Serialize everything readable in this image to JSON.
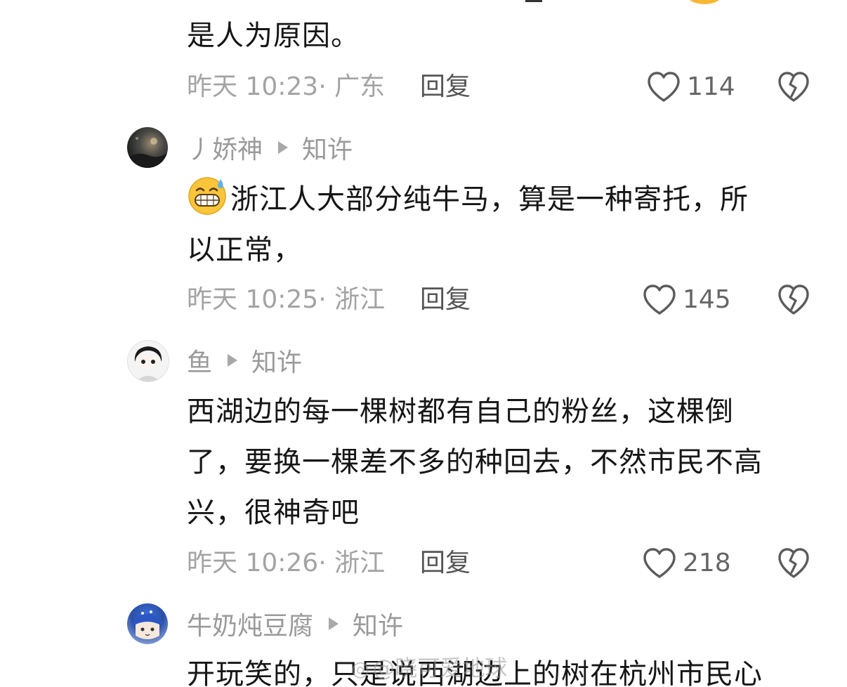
{
  "comments": [
    {
      "text_lines": [
        "是人为原因。"
      ],
      "time": "昨天 10:23· 广东",
      "reply": "回复",
      "likes": "114"
    },
    {
      "author": "丿娇神",
      "replied_to": "知许",
      "emoji": "grinning-sweat-emoji",
      "text_lines": [
        "浙江人大部分纯牛马，算是一种寄托，所",
        "以正常，"
      ],
      "time": "昨天 10:25· 浙江",
      "reply": "回复",
      "likes": "145"
    },
    {
      "author": "鱼",
      "replied_to": "知许",
      "text_lines": [
        "西湖边的每一棵树都有自己的粉丝，这棵倒",
        "了，要换一棵差不多的种回去，不然市民不高",
        "兴，很神奇吧"
      ],
      "time": "昨天 10:26· 浙江",
      "reply": "回复",
      "likes": "218"
    },
    {
      "author": "牛奶炖豆腐",
      "replied_to": "知许",
      "text_lines": [
        "开玩笑的，只是说西湖边上的树在杭州市民心"
      ]
    }
  ],
  "watermark": "@晓可爱地球",
  "icons": {
    "like": "heart-outline-icon",
    "dislike": "broken-heart-icon",
    "reply_arrow": "triangle-right-icon"
  },
  "colors": {
    "text": "#161616",
    "meta": "#a3a3a3",
    "author": "#9a9a9a"
  }
}
